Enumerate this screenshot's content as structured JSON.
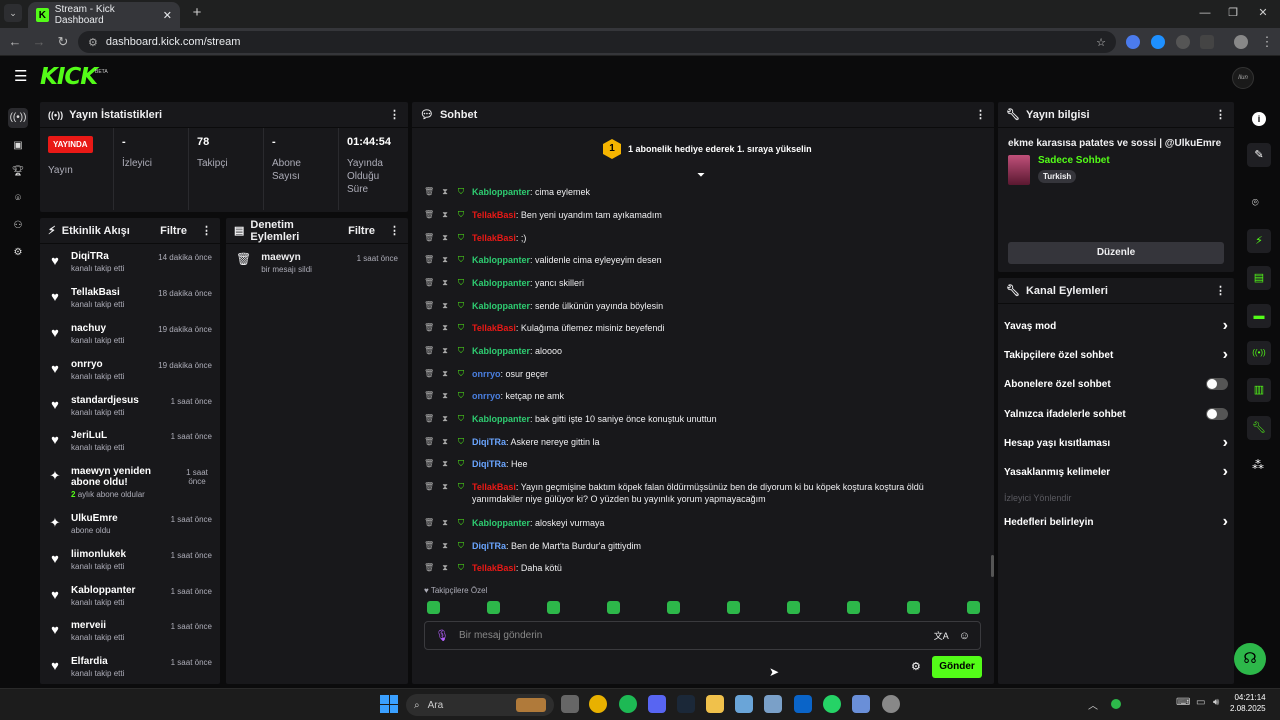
{
  "browser": {
    "tab_title": "Stream - Kick Dashboard",
    "url": "dashboard.kick.com/stream"
  },
  "header": {
    "logo": "KICK",
    "beta": "BETA",
    "avatar_text": "Ilun"
  },
  "stats": {
    "title": "Yayın İstatistikleri",
    "live_badge": "YAYINDA",
    "live_label": "Yayın",
    "viewers_value": "-",
    "viewers_label": "İzleyici",
    "followers_value": "78",
    "followers_label": "Takipçi",
    "subs_value": "-",
    "subs_label": "Abone Sayısı",
    "duration_value": "01:44:54",
    "duration_label": "Yayında Olduğu Süre"
  },
  "activity": {
    "title": "Etkinlik Akışı",
    "filter": "Filtre",
    "items": [
      {
        "name": "DiqiTRa",
        "sub": "kanalı takip etti",
        "time": "14 dakika önce",
        "icon": "heart-icon"
      },
      {
        "name": "TellakBasi",
        "sub": "kanalı takip etti",
        "time": "18 dakika önce",
        "icon": "heart-icon"
      },
      {
        "name": "nachuy",
        "sub": "kanalı takip etti",
        "time": "19 dakika önce",
        "icon": "heart-icon"
      },
      {
        "name": "onrryo",
        "sub": "kanalı takip etti",
        "time": "19 dakika önce",
        "icon": "heart-icon"
      },
      {
        "name": "standardjesus",
        "sub": "kanalı takip etti",
        "time": "1 saat önce",
        "icon": "heart-icon"
      },
      {
        "name": "JeriLuL",
        "sub": "kanalı takip etti",
        "time": "1 saat önce",
        "icon": "heart-icon"
      },
      {
        "name": "maewyn yeniden abone oldu!",
        "sub_count": "2",
        "sub": "aylık abone oldular",
        "time": "1 saat önce",
        "icon": "sparkle-icon"
      },
      {
        "name": "UlkuEmre",
        "sub": "abone oldu",
        "time": "1 saat önce",
        "icon": "sparkle-icon"
      },
      {
        "name": "liimonlukek",
        "sub": "kanalı takip etti",
        "time": "1 saat önce",
        "icon": "heart-icon"
      },
      {
        "name": "Kabloppanter",
        "sub": "kanalı takip etti",
        "time": "1 saat önce",
        "icon": "heart-icon"
      },
      {
        "name": "merveii",
        "sub": "kanalı takip etti",
        "time": "1 saat önce",
        "icon": "heart-icon"
      },
      {
        "name": "Elfardia",
        "sub": "kanalı takip etti",
        "time": "1 saat önce",
        "icon": "heart-icon"
      }
    ]
  },
  "moderation": {
    "title": "Denetim Eylemleri",
    "filter": "Filtre",
    "items": [
      {
        "name": "maewyn",
        "sub": "bir mesajı sildi",
        "time": "1 saat önce"
      }
    ]
  },
  "chat": {
    "title": "Sohbet",
    "goal_badge": "1",
    "goal_text": "1 abonelik hediye ederek 1. sıraya yükselin",
    "messages": [
      {
        "user": "Kabloppanter",
        "color": "#2ecc71",
        "text": ": cima eylemek"
      },
      {
        "user": "TellakBasi",
        "color": "#e91916",
        "text": ": Ben yeni uyandım tam ayıkamadım"
      },
      {
        "user": "TellakBasi",
        "color": "#e91916",
        "text": ": ;)"
      },
      {
        "user": "Kabloppanter",
        "color": "#2ecc71",
        "text": ": validenle cima eyleyeyim desen"
      },
      {
        "user": "Kabloppanter",
        "color": "#2ecc71",
        "text": ": yancı skilleri"
      },
      {
        "user": "Kabloppanter",
        "color": "#2ecc71",
        "text": ": sende ülkünün yayında böylesin"
      },
      {
        "user": "TellakBasi",
        "color": "#e91916",
        "text": ": Kulağıma üflemez misiniz beyefendi"
      },
      {
        "user": "Kabloppanter",
        "color": "#2ecc71",
        "text": ": aloooo"
      },
      {
        "user": "onrryo",
        "color": "#4a7fe0",
        "text": ": osur geçer"
      },
      {
        "user": "onrryo",
        "color": "#4a7fe0",
        "text": ": ketçap ne amk"
      },
      {
        "user": "Kabloppanter",
        "color": "#2ecc71",
        "text": ": bak gitti işte 10 saniye önce konuştuk unuttun"
      },
      {
        "user": "DiqiTRa",
        "color": "#6aa5ff",
        "text": ": Askere nereye gittin la"
      },
      {
        "user": "DiqiTRa",
        "color": "#6aa5ff",
        "text": ": Hee"
      },
      {
        "user": "TellakBasi",
        "color": "#e91916",
        "text": ": Yayın geçmişine baktım köpek falan öldürmüşsünüz ben de diyorum ki bu köpek koştura koştura öldü yanımdakiler niye gülüyor ki? O yüzden bu yayınlık yorum yapmayacağım"
      },
      {
        "user": "Kabloppanter",
        "color": "#2ecc71",
        "text": ": aloskeyi vurmaya"
      },
      {
        "user": "DiqiTRa",
        "color": "#6aa5ff",
        "text": ": Ben de Mart'ta Burdur'a gittiydim"
      },
      {
        "user": "TellakBasi",
        "color": "#e91916",
        "text": ": Daha kötü"
      }
    ],
    "followers_only": "Takipçilere Özel",
    "input_placeholder": "Bir mesaj gönderin",
    "send": "Gönder"
  },
  "stream_info": {
    "title": "Yayın bilgisi",
    "stream_title": "ekme karasısa patates ve sossi | @UlkuEmre",
    "category": "Sadece Sohbet",
    "language": "Turkish",
    "edit": "Düzenle"
  },
  "channel_actions": {
    "title": "Kanal Eylemleri",
    "items": [
      {
        "label": "Yavaş mod",
        "control": "chevron"
      },
      {
        "label": "Takipçilere özel sohbet",
        "control": "chevron"
      },
      {
        "label": "Abonelere özel sohbet",
        "control": "toggle"
      },
      {
        "label": "Yalnızca ifadelerle sohbet",
        "control": "toggle"
      },
      {
        "label": "Hesap yaşı kısıtlaması",
        "control": "chevron"
      },
      {
        "label": "Yasaklanmış kelimeler",
        "control": "chevron"
      },
      {
        "label": "İzleyici Yönlendir",
        "control": "disabled"
      },
      {
        "label": "Hedefleri belirleyin",
        "control": "chevron"
      }
    ]
  },
  "taskbar": {
    "search": "Ara",
    "time": "04:21:14",
    "date": "2.08.2025"
  },
  "colors": {
    "accent": "#53fc18",
    "live": "#e91916",
    "panel": "#18181b",
    "bg": "#0b0b0c"
  }
}
